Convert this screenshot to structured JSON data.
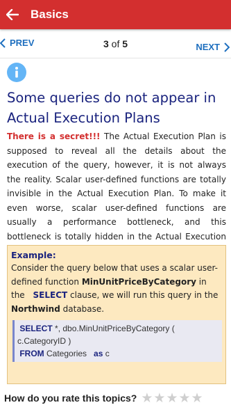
{
  "appbar": {
    "title": "Basics",
    "back_icon": "arrow-left-icon"
  },
  "pager": {
    "prev_label": "PREV",
    "current": "3",
    "of_text": "of",
    "total": "5",
    "next_label": "NEXT"
  },
  "content": {
    "info_icon": "info-icon",
    "heading": "Some queries do not appear in Actual Execution Plans",
    "secret": "There is a secret!!!",
    "body": " The Actual Execution Plan is supposed to reveal all the details about the execution of the query, however, it is not always the reality. Scalar user-defined functions are totally invisible in the Actual Execution Plan. To make it even worse, scalar user-defined functions are usually a performance bottleneck, and this bottleneck is totally hidden in the Actual Execution Plan."
  },
  "example": {
    "title": "Example:",
    "line1": "Consider the query below that uses a scalar user-defined function ",
    "function_name": "MinUnitPriceByCategory",
    "line2": " in the ",
    "select_kw": "SELECT",
    "line3": " clause, we will run this query in the ",
    "db_name": "Northwind",
    "line4": " database.",
    "code": {
      "select": "SELECT",
      "select_rest": " *, dbo.MinUnitPriceByCategory ( c.CategoryID )",
      "from": "FROM",
      "table": " Categories ",
      "as": "as",
      "alias": " c"
    }
  },
  "rating": {
    "label": "How do you rate this topics?",
    "value": 0,
    "max": 5,
    "star_icon": "star-icon",
    "empty_color": "#cfcfcf"
  },
  "colors": {
    "appbar": "#d32f2f",
    "link": "#1e6fbf",
    "heading": "#1a237e",
    "example_bg": "#fde9c0"
  }
}
